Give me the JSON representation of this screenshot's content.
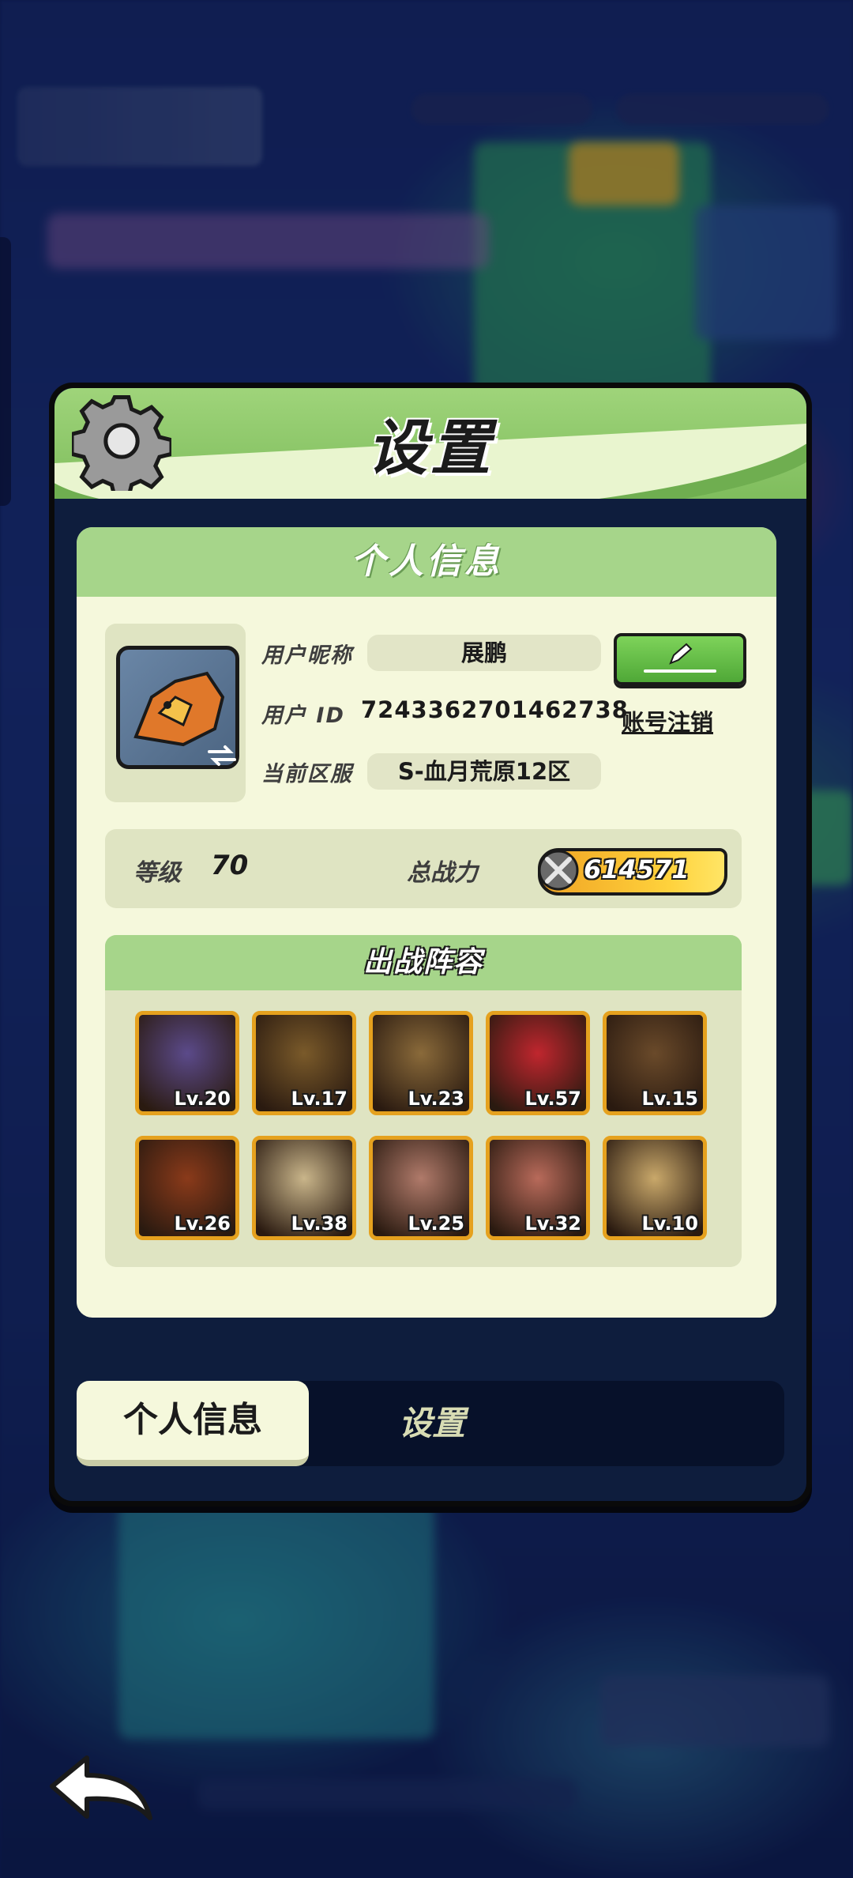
{
  "window": {
    "title": "设置",
    "gear_icon": "gear-icon"
  },
  "profile": {
    "section_title": "个人信息",
    "nickname_label": "用户昵称",
    "nickname_value": "展鹏",
    "id_label": "用户 ID",
    "id_value": "7243362701462738",
    "server_label": "当前区服",
    "server_value": "S-血月荒原12区",
    "cancel_account": "账号注销",
    "edit_icon": "pencil-icon"
  },
  "stats": {
    "level_label": "等级",
    "level_value": "70",
    "power_label": "总战力",
    "power_value": "614571"
  },
  "lineup": {
    "title": "出战阵容",
    "heroes": [
      {
        "level": "Lv.20",
        "color": "#5b4a8a"
      },
      {
        "level": "Lv.17",
        "color": "#7a5a2a"
      },
      {
        "level": "Lv.23",
        "color": "#8a6a3a"
      },
      {
        "level": "Lv.57",
        "color": "#c0262e"
      },
      {
        "level": "Lv.15",
        "color": "#6a4a2a"
      },
      {
        "level": "Lv.26",
        "color": "#8a3a1a"
      },
      {
        "level": "Lv.38",
        "color": "#c9b58a"
      },
      {
        "level": "Lv.25",
        "color": "#b07a6a"
      },
      {
        "level": "Lv.32",
        "color": "#b86a5a"
      },
      {
        "level": "Lv.10",
        "color": "#c9a86a"
      }
    ]
  },
  "tabs": {
    "active": "个人信息",
    "inactive": "设置"
  },
  "colors": {
    "panel_green": "#9fd47a",
    "panel_cream": "#f5f8dc",
    "card_bg": "#dfe4c2",
    "frame_gold": "#e5a11e",
    "button_green": "#7ed35a"
  }
}
